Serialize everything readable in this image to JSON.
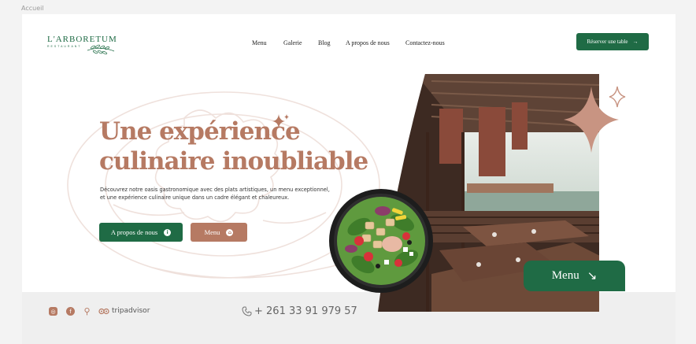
{
  "frame": {
    "label": "Accueil"
  },
  "brand": {
    "name": "L'ARBORETUM",
    "tagline": "RESTAURANT"
  },
  "nav": {
    "items": [
      "Menu",
      "Galerie",
      "Blog",
      "A propos de nous",
      "Contactez-nous"
    ]
  },
  "header": {
    "reserve_label": "Réserver une table",
    "reserve_arrow": "→"
  },
  "hero": {
    "title_line1": "Une expérience",
    "title_line2": "culinaire inoubliable",
    "description_line1": "Découvrez notre oasis gastronomique avec des plats artistiques, un menu exceptionnel,",
    "description_line2": "et une expérience culinaire unique dans un cadre élégant et chaleureux.",
    "about_label": "A propos de nous",
    "about_icon": "i",
    "menu_label": "Menu",
    "menu_icon": "⌂"
  },
  "menu_tab": {
    "label": "Menu",
    "arrow": "↘"
  },
  "footer": {
    "social": [
      "instagram-icon",
      "facebook-icon",
      "location-pin-icon"
    ],
    "tripadvisor": "tripadvisor",
    "phone": "+ 261 33 91 979 57"
  },
  "colors": {
    "green": "#1f6b45",
    "terracotta": "#b67a63",
    "footer_bg": "#efefef"
  }
}
